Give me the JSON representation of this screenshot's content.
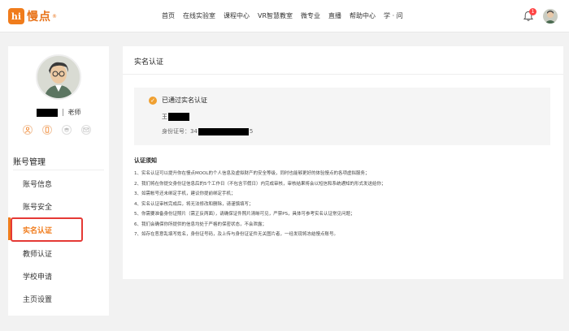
{
  "header": {
    "logo_mark": "hi",
    "logo_text": "慢点",
    "logo_reg": "®",
    "nav": [
      "首页",
      "在线实验室",
      "课程中心",
      "VR智慧教室",
      "微专业",
      "直播",
      "帮助中心",
      "学 · 问"
    ],
    "bell_icon": "bell-icon",
    "notify_count": "1"
  },
  "sidebar": {
    "role": "老师",
    "icons": [
      "user-icon",
      "phone-icon",
      "cap-icon",
      "mail-icon"
    ],
    "menu_title": "账号管理",
    "items": [
      "账号信息",
      "账号安全",
      "实名认证",
      "教师认证",
      "学校申请",
      "主页设置"
    ],
    "active_index": 2
  },
  "main": {
    "title": "实名认证",
    "status": "已通过实名认证",
    "name_prefix": "王",
    "id_label": "身份证号：34",
    "id_suffix": "5",
    "notice_title": "认证须知",
    "notices": [
      "1、实名认证可以提升你在慢点MOOL的个人信息及虚拟财产的安全等级，同时也能够更好的体验慢点的各项虚拟服务；",
      "2、我们将在你提交身份证信息后的5个工作日（不包含节假日）内完成审核，审核结果将会以短信和系统通知的形式发送给你；",
      "3、如需帐号还未绑定手机，建议你提前绑定手机；",
      "4、实名认证审核完成后，将无法修改和删除，请谨慎填写；",
      "5、你需要准备身份证照片（需正反两面），请确保证件照片清晰可见，严禁PS，具体可参考实名认证常见问题；",
      "6、我们会确保你所提供的信息均处于严格的保密状态，不会泄露；",
      "7、如存在恶意乱填写姓名，身份证号码，及上传与身份证证件无关图片者，一经发现将冻结慢点账号。"
    ]
  },
  "colors": {
    "accent": "#f07c1c",
    "highlight": "#e53935",
    "bg": "#f2f2f2"
  }
}
